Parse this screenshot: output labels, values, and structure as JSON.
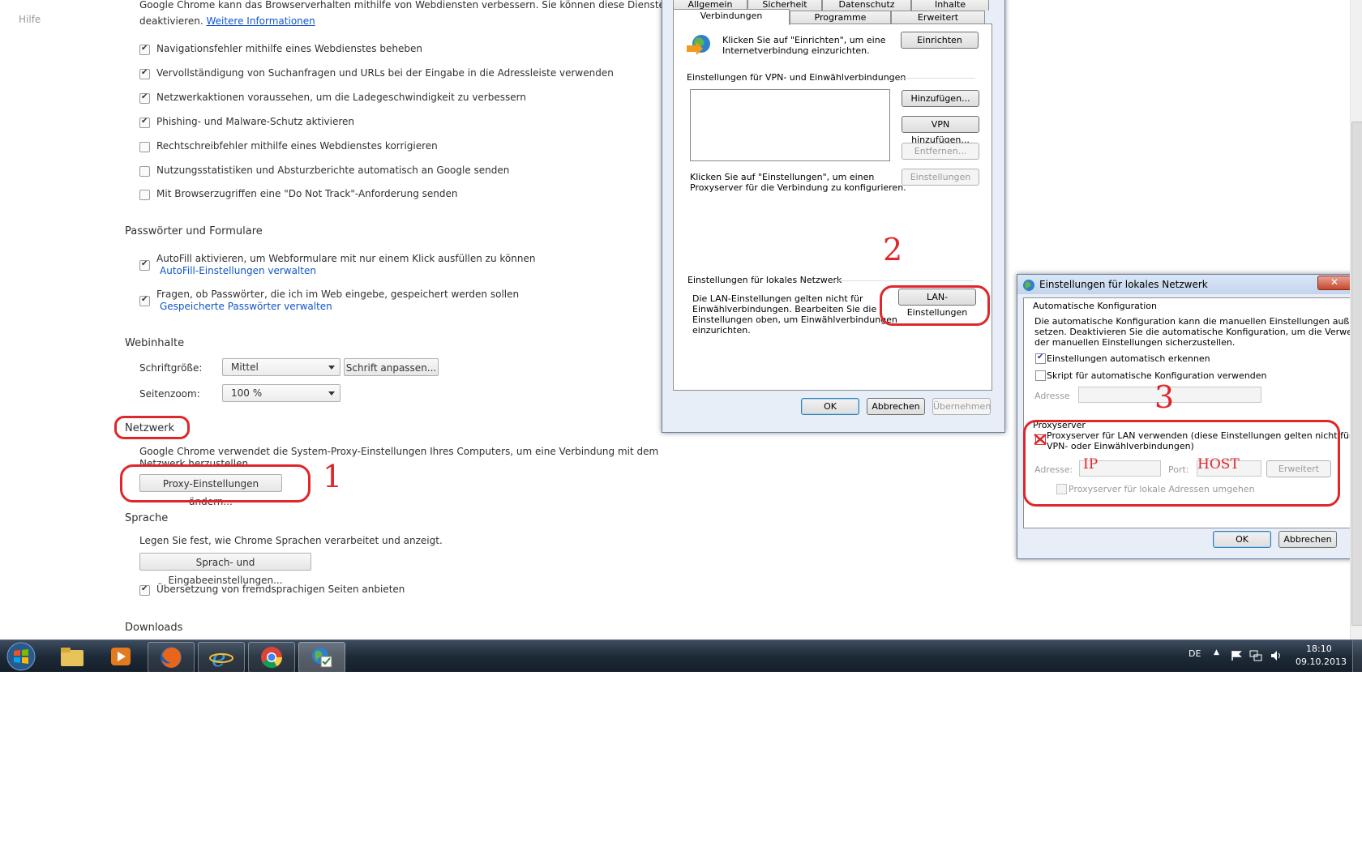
{
  "chrome": {
    "nav_help": "Hilfe",
    "privacy_intro_line1": "Google Chrome kann das Browserverhalten mithilfe von Webdiensten verbessern. Sie können diese Dienste",
    "privacy_intro_line2": "deaktivieren.",
    "privacy_more_link": "Weitere Informationen",
    "privacy_options": [
      {
        "label": "Navigationsfehler mithilfe eines Webdienstes beheben",
        "checked": true
      },
      {
        "label": "Vervollständigung von Suchanfragen und URLs bei der Eingabe in die Adressleiste verwenden",
        "checked": true
      },
      {
        "label": "Netzwerkaktionen voraussehen, um die Ladegeschwindigkeit zu verbessern",
        "checked": true
      },
      {
        "label": "Phishing- und Malware-Schutz aktivieren",
        "checked": true
      },
      {
        "label": "Rechtschreibfehler mithilfe eines Webdienstes korrigieren",
        "checked": false
      },
      {
        "label": "Nutzungsstatistiken und Absturzberichte automatisch an Google senden",
        "checked": false
      },
      {
        "label": "Mit Browserzugriffen eine \"Do Not Track\"-Anforderung senden",
        "checked": false
      }
    ],
    "passwords": {
      "title": "Passwörter und Formulare",
      "autofill_label": "AutoFill aktivieren, um Webformulare mit nur einem Klick ausfüllen zu können",
      "autofill_link": "AutoFill-Einstellungen verwalten",
      "save_passwords_label": "Fragen, ob Passwörter, die ich im Web eingebe, gespeichert werden sollen",
      "save_passwords_link": "Gespeicherte Passwörter verwalten"
    },
    "web_content": {
      "title": "Webinhalte",
      "font_size_label": "Schriftgröße:",
      "font_size_value": "Mittel",
      "customize_fonts_button": "Schrift anpassen...",
      "zoom_label": "Seitenzoom:",
      "zoom_value": "100 %"
    },
    "network": {
      "title": "Netzwerk",
      "desc_line1": "Google Chrome verwendet die System-Proxy-Einstellungen Ihres Computers, um eine Verbindung mit dem",
      "desc_line2": "Netzwerk herzustellen.",
      "proxy_button": "Proxy-Einstellungen ändern..."
    },
    "language": {
      "title": "Sprache",
      "desc": "Legen Sie fest, wie Chrome Sprachen verarbeitet und anzeigt.",
      "lang_button": "Sprach- und Eingabeeinstellungen...",
      "translate_label": "Übersetzung von fremdsprachigen Seiten anbieten"
    },
    "downloads_title": "Downloads"
  },
  "annotations": {
    "one": "1",
    "two": "2",
    "three": "3"
  },
  "inet_dialog": {
    "tabs_top": [
      "Allgemein",
      "Sicherheit",
      "Datenschutz",
      "Inhalte"
    ],
    "tabs_bottom": [
      "Verbindungen",
      "Programme",
      "Erweitert"
    ],
    "setup_text_line1": "Klicken Sie auf \"Einrichten\", um eine",
    "setup_text_line2": "Internetverbindung einzurichten.",
    "setup_button": "Einrichten",
    "vpn_group": "Einstellungen für VPN- und Einwählverbindungen",
    "add_button": "Hinzufügen...",
    "add_vpn_button": "VPN hinzufügen...",
    "remove_button": "Entfernen...",
    "settings_button": "Einstellungen",
    "proxy_text_line1": "Klicken Sie auf \"Einstellungen\", um einen",
    "proxy_text_line2": "Proxyserver für die Verbindung zu konfigurieren.",
    "lan_group": "Einstellungen für lokales Netzwerk",
    "lan_text_line1": "Die LAN-Einstellungen gelten nicht für",
    "lan_text_line2": "Einwählverbindungen. Bearbeiten Sie die",
    "lan_text_line3": "Einstellungen oben, um Einwählverbindungen",
    "lan_text_line4": "einzurichten.",
    "lan_button": "LAN-Einstellungen",
    "ok": "OK",
    "cancel": "Abbrechen",
    "apply": "Übernehmen"
  },
  "lan_dialog": {
    "title": "Einstellungen für lokales Netzwerk",
    "auto_group": "Automatische Konfiguration",
    "auto_desc_line1": "Die automatische Konfiguration kann die manuellen Einstellungen außer Kraft",
    "auto_desc_line2": "setzen. Deaktivieren Sie die automatische Konfiguration, um die Verwendung",
    "auto_desc_line3": "der manuellen Einstellungen sicherzustellen.",
    "auto_detect_label": "Einstellungen automatisch erkennen",
    "script_label": "Skript für automatische Konfiguration verwenden",
    "address_label": "Adresse",
    "proxy_group": "Proxyserver",
    "use_proxy_line1": "Proxyserver für LAN verwenden (diese Einstellungen gelten nicht für",
    "use_proxy_line2": "VPN- oder Einwählverbindungen)",
    "proxy_address_label": "Adresse:",
    "proxy_address_value": "IP",
    "port_label": "Port:",
    "port_value": "HOST",
    "advanced_button": "Erweitert",
    "bypass_label": "Proxyserver für lokale Adressen umgehen",
    "ok": "OK",
    "cancel": "Abbrechen"
  },
  "taskbar": {
    "language": "DE",
    "time": "18:10",
    "date": "09.10.2013"
  },
  "colors": {
    "annotation_red": "#e0262b",
    "link_blue": "#1155cc",
    "taskbar": "#1e2a38"
  }
}
